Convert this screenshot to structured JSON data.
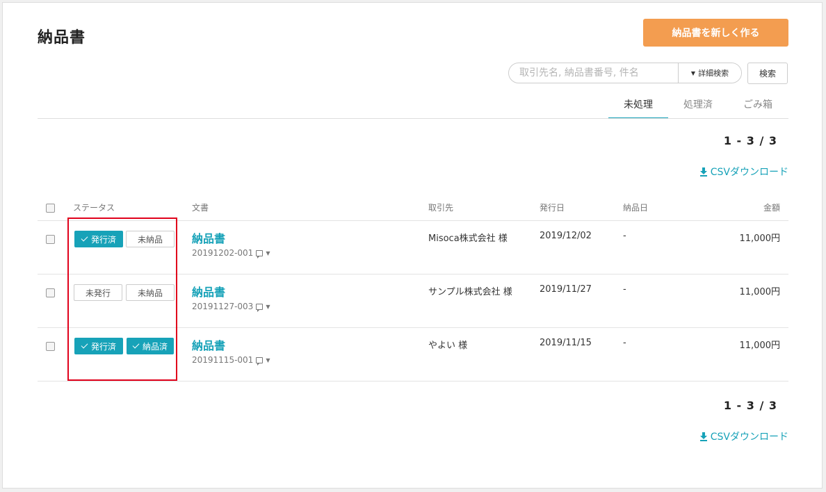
{
  "page": {
    "title": "納品書",
    "new_button": "納品書を新しく作る"
  },
  "search": {
    "placeholder": "取引先名, 納品書番号, 件名",
    "value": "",
    "advanced_label": "詳細検索",
    "submit_label": "検索"
  },
  "tabs": [
    {
      "label": "未処理",
      "active": true
    },
    {
      "label": "処理済",
      "active": false
    },
    {
      "label": "ごみ箱",
      "active": false
    }
  ],
  "pagination": {
    "summary": "1 - 3 / 3"
  },
  "csv": {
    "label": "CSVダウンロード"
  },
  "table": {
    "headers": {
      "status": "ステータス",
      "document": "文書",
      "client": "取引先",
      "issue_date": "発行日",
      "delivery_date": "納品日",
      "amount": "金額"
    },
    "rows": [
      {
        "issued": {
          "label": "発行済",
          "checked": true
        },
        "delivered": {
          "label": "未納品",
          "checked": false
        },
        "doc_title": "納品書",
        "doc_number": "20191202-001",
        "client": "Misoca株式会社 様",
        "issue_date": "2019/12/02",
        "delivery_date": "-",
        "amount": "11,000円"
      },
      {
        "issued": {
          "label": "未発行",
          "checked": false
        },
        "delivered": {
          "label": "未納品",
          "checked": false
        },
        "doc_title": "納品書",
        "doc_number": "20191127-003",
        "client": "サンプル株式会社 様",
        "issue_date": "2019/11/27",
        "delivery_date": "-",
        "amount": "11,000円"
      },
      {
        "issued": {
          "label": "発行済",
          "checked": true
        },
        "delivered": {
          "label": "納品済",
          "checked": true
        },
        "doc_title": "納品書",
        "doc_number": "20191115-001",
        "client": "やよい 様",
        "issue_date": "2019/11/15",
        "delivery_date": "-",
        "amount": "11,000円"
      }
    ]
  },
  "colors": {
    "accent": "#17a2b8",
    "primary_button": "#f39d50",
    "highlight_box": "#e0001b"
  },
  "icons": {
    "download": "download-icon",
    "memo": "memo-icon",
    "caret": "caret-down-icon",
    "check": "check-icon"
  }
}
